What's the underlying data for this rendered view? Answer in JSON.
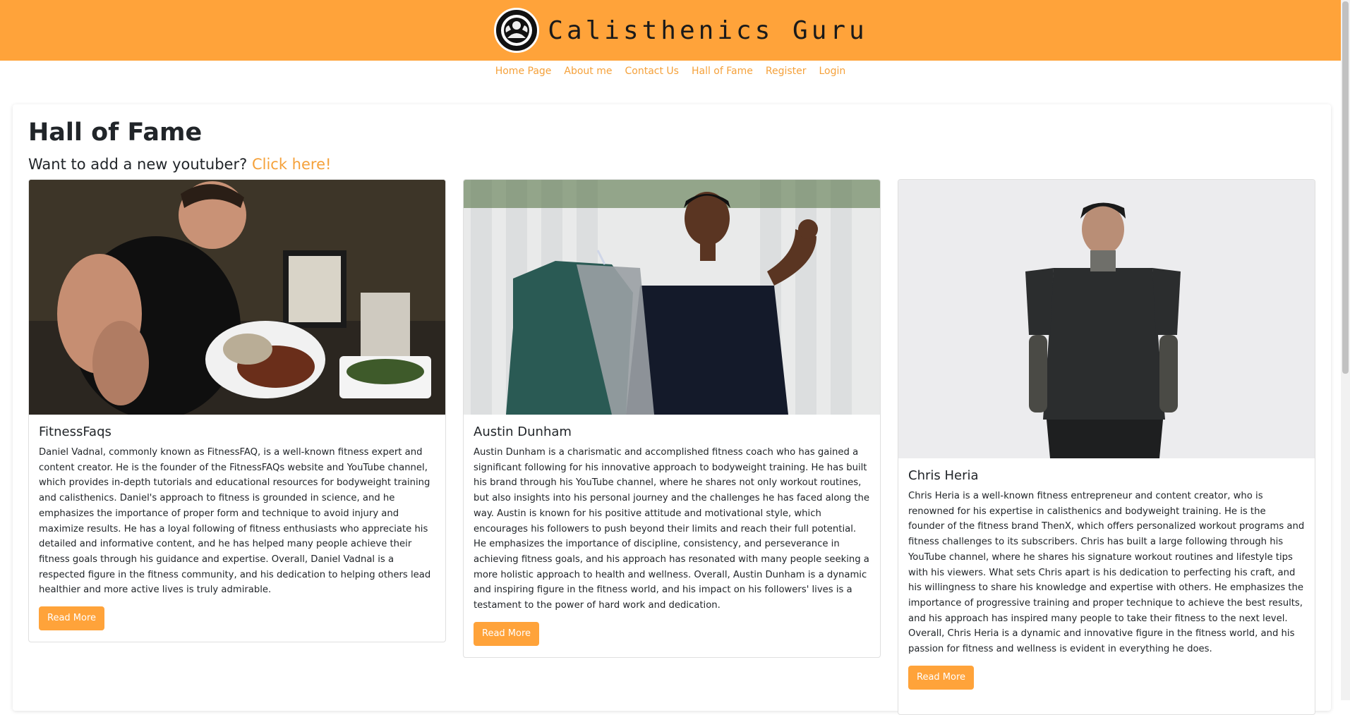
{
  "brand": {
    "name": "Calisthenics Guru",
    "logo_icon": "strongman-logo-icon"
  },
  "nav": [
    "Home Page",
    "About me",
    "Contact Us",
    "Hall of Fame",
    "Register",
    "Login"
  ],
  "page": {
    "title": "Hall of Fame",
    "subtitle_prefix": "Want to add a new youtuber?",
    "subtitle_link": "Click here!"
  },
  "cards": [
    {
      "title": "FitnessFaqs",
      "text": "Daniel Vadnal, commonly known as FitnessFAQ, is a well-known fitness expert and content creator. He is the founder of the FitnessFAQs website and YouTube channel, which provides in-depth tutorials and educational resources for bodyweight training and calisthenics. Daniel's approach to fitness is grounded in science, and he emphasizes the importance of proper form and technique to avoid injury and maximize results. He has a loyal following of fitness enthusiasts who appreciate his detailed and informative content, and he has helped many people achieve their fitness goals through his guidance and expertise. Overall, Daniel Vadnal is a respected figure in the fitness community, and his dedication to helping others lead healthier and more active lives is truly admirable.",
      "button": "Read More"
    },
    {
      "title": "Austin Dunham",
      "text": "Austin Dunham is a charismatic and accomplished fitness coach who has gained a significant following for his innovative approach to bodyweight training. He has built his brand through his YouTube channel, where he shares not only workout routines, but also insights into his personal journey and the challenges he has faced along the way. Austin is known for his positive attitude and motivational style, which encourages his followers to push beyond their limits and reach their full potential. He emphasizes the importance of discipline, consistency, and perseverance in achieving fitness goals, and his approach has resonated with many people seeking a more holistic approach to health and wellness. Overall, Austin Dunham is a dynamic and inspiring figure in the fitness world, and his impact on his followers' lives is a testament to the power of hard work and dedication.",
      "button": "Read More"
    },
    {
      "title": "Chris Heria",
      "text": "Chris Heria is a well-known fitness entrepreneur and content creator, who is renowned for his expertise in calisthenics and bodyweight training. He is the founder of the fitness brand ThenX, which offers personalized workout programs and fitness challenges to its subscribers. Chris has built a large following through his YouTube channel, where he shares his signature workout routines and lifestyle tips with his viewers. What sets Chris apart is his dedication to perfecting his craft, and his willingness to share his knowledge and expertise with others. He emphasizes the importance of progressive training and proper technique to achieve the best results, and his approach has inspired many people to take their fitness to the next level. Overall, Chris Heria is a dynamic and innovative figure in the fitness world, and his passion for fitness and wellness is evident in everything he does.",
      "button": "Read More"
    }
  ]
}
